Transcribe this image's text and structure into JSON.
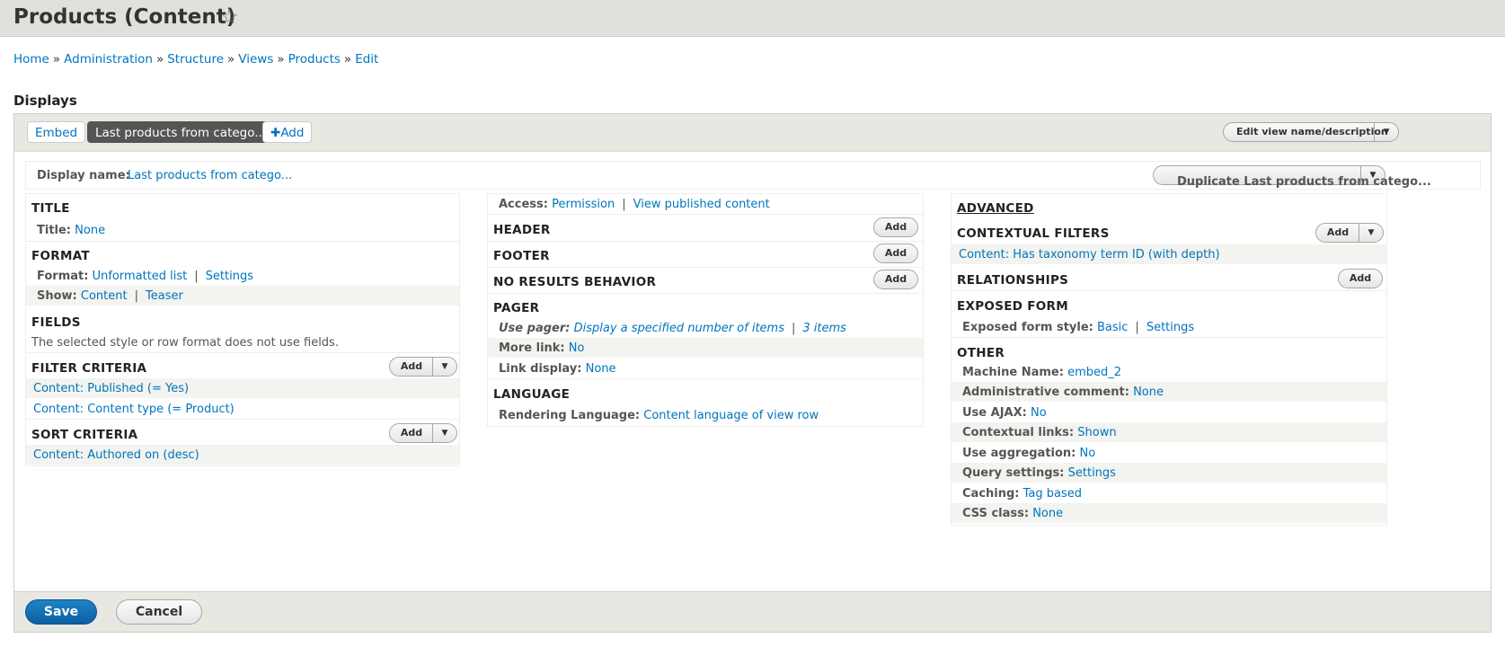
{
  "page": {
    "title": "Products (Content)"
  },
  "breadcrumb": [
    "Home",
    "Administration",
    "Structure",
    "Views",
    "Products",
    "Edit"
  ],
  "breadcrumb_sep": "»",
  "displays": {
    "heading": "Displays",
    "tabs": [
      "Embed",
      "Last products from catego...",
      "Add"
    ],
    "edit_view_label": "Edit view name/description",
    "display_name_label": "Display name:",
    "display_name_value": "Last products from catego...",
    "duplicate_label": "Duplicate Last products from catego..."
  },
  "col1": {
    "title_h": "TITLE",
    "title_k": "Title:",
    "title_v": "None",
    "format_h": "FORMAT",
    "format_k": "Format:",
    "format_v": "Unformatted list",
    "format_settings": "Settings",
    "show_k": "Show:",
    "show_v": "Content",
    "show_v2": "Teaser",
    "fields_h": "FIELDS",
    "fields_note": "The selected style or row format does not use fields.",
    "filter_h": "FILTER CRITERIA",
    "filters": [
      "Content: Published (= Yes)",
      "Content: Content type (= Product)"
    ],
    "sort_h": "SORT CRITERIA",
    "sorts": [
      "Content: Authored on (desc)"
    ],
    "add": "Add"
  },
  "col2": {
    "access_k": "Access:",
    "access_v": "Permission",
    "access_v2": "View published content",
    "header_h": "HEADER",
    "footer_h": "FOOTER",
    "noresults_h": "NO RESULTS BEHAVIOR",
    "pager_h": "PAGER",
    "pager_k": "Use pager:",
    "pager_v": "Display a specified number of items",
    "pager_v2": "3 items",
    "more_k": "More link:",
    "more_v": "No",
    "linkdisp_k": "Link display:",
    "linkdisp_v": "None",
    "lang_h": "LANGUAGE",
    "lang_k": "Rendering Language:",
    "lang_v": "Content language of view row",
    "add": "Add"
  },
  "col3": {
    "advanced_h": "ADVANCED",
    "ctx_h": "CONTEXTUAL FILTERS",
    "ctx_item": "Content: Has taxonomy term ID (with depth)",
    "rel_h": "RELATIONSHIPS",
    "exposed_h": "EXPOSED FORM",
    "exposed_k": "Exposed form style:",
    "exposed_v": "Basic",
    "exposed_v2": "Settings",
    "other_h": "OTHER",
    "other": [
      {
        "k": "Machine Name:",
        "v": "embed_2"
      },
      {
        "k": "Administrative comment:",
        "v": "None"
      },
      {
        "k": "Use AJAX:",
        "v": "No"
      },
      {
        "k": "Contextual links:",
        "v": "Shown"
      },
      {
        "k": "Use aggregation:",
        "v": "No"
      },
      {
        "k": "Query settings:",
        "v": "Settings"
      },
      {
        "k": "Caching:",
        "v": "Tag based"
      },
      {
        "k": "CSS class:",
        "v": "None"
      }
    ],
    "add": "Add"
  },
  "footer": {
    "save": "Save",
    "cancel": "Cancel"
  }
}
